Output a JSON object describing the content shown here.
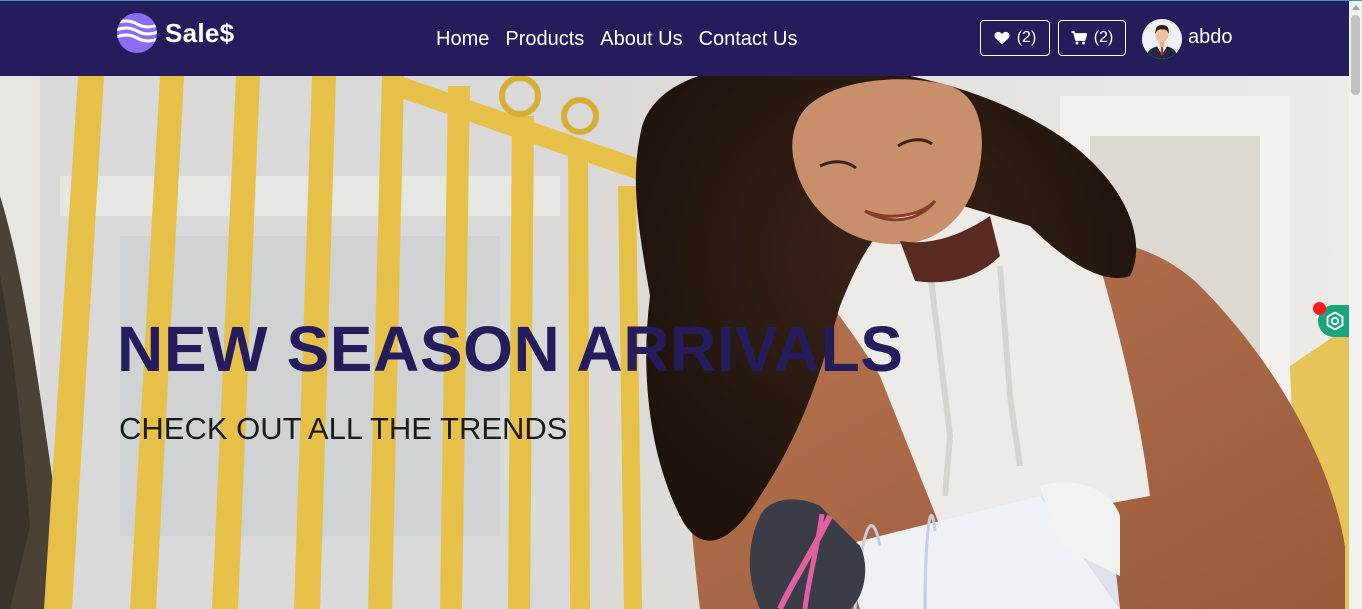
{
  "brand": {
    "name": "Sale$",
    "logo_icon": "wave-globe-icon"
  },
  "nav": {
    "links": [
      {
        "label": "Home"
      },
      {
        "label": "Products"
      },
      {
        "label": "About Us"
      },
      {
        "label": "Contact Us"
      }
    ]
  },
  "wishlist": {
    "icon": "heart-icon",
    "count": "(2)"
  },
  "cart": {
    "icon": "cart-icon",
    "count": "(2)"
  },
  "user": {
    "name": "abdo",
    "avatar_icon": "user-avatar-icon"
  },
  "hero": {
    "title": "NEW SEASON ARRIVALS",
    "subtitle": "CHECK OUT ALL THE TRENDS",
    "image": "woman-with-shopping-bag-photo"
  },
  "extension": {
    "icon": "hexagon-extension-icon"
  },
  "colors": {
    "navbar": "#251c5c",
    "accent": "#251c5c",
    "extension": "#1aa57a",
    "notification_dot": "#ff1a1a"
  }
}
